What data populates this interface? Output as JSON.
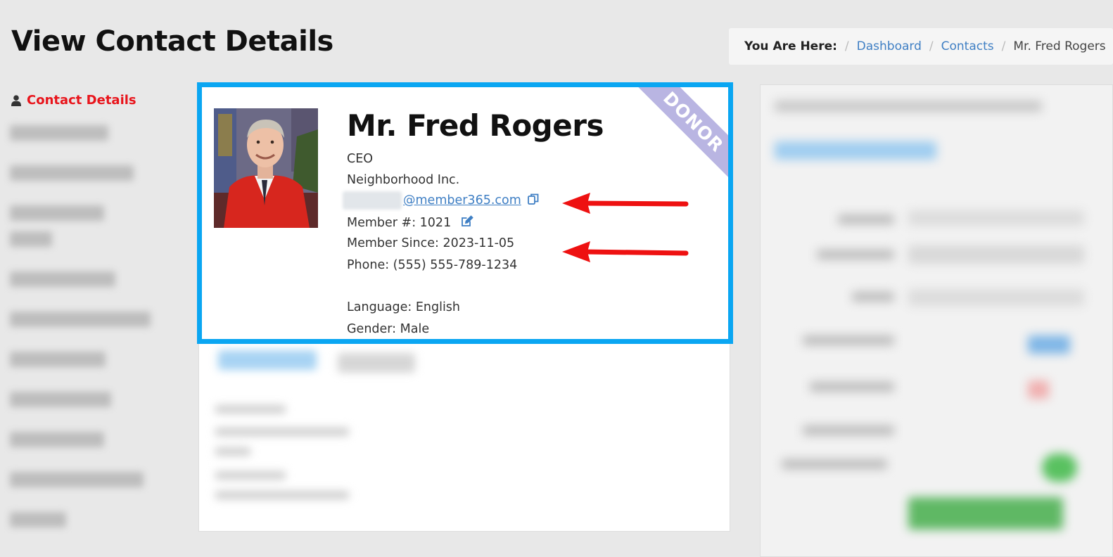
{
  "page": {
    "title": "View Contact Details"
  },
  "breadcrumb": {
    "lead": "You Are Here:",
    "items": [
      "Dashboard",
      "Contacts"
    ],
    "current": "Mr. Fred Rogers"
  },
  "sidebar": {
    "active_label": "Contact Details"
  },
  "contact": {
    "name": "Mr. Fred Rogers",
    "job_title": "CEO",
    "company": "Neighborhood Inc.",
    "email_domain": "@member365.com",
    "member_number": "Member #: 1021",
    "member_since": "Member Since: 2023-11-05",
    "phone": "Phone: (555) 555-789-1234",
    "language": "Language: English",
    "gender": "Gender: Male",
    "ribbon": "DONOR"
  },
  "colors": {
    "accent_link": "#3f7fc4",
    "highlight_border": "#0aa6f2",
    "active_red": "#e8141b",
    "arrow_red": "#ee1111",
    "ribbon": "#b9b5e2"
  }
}
